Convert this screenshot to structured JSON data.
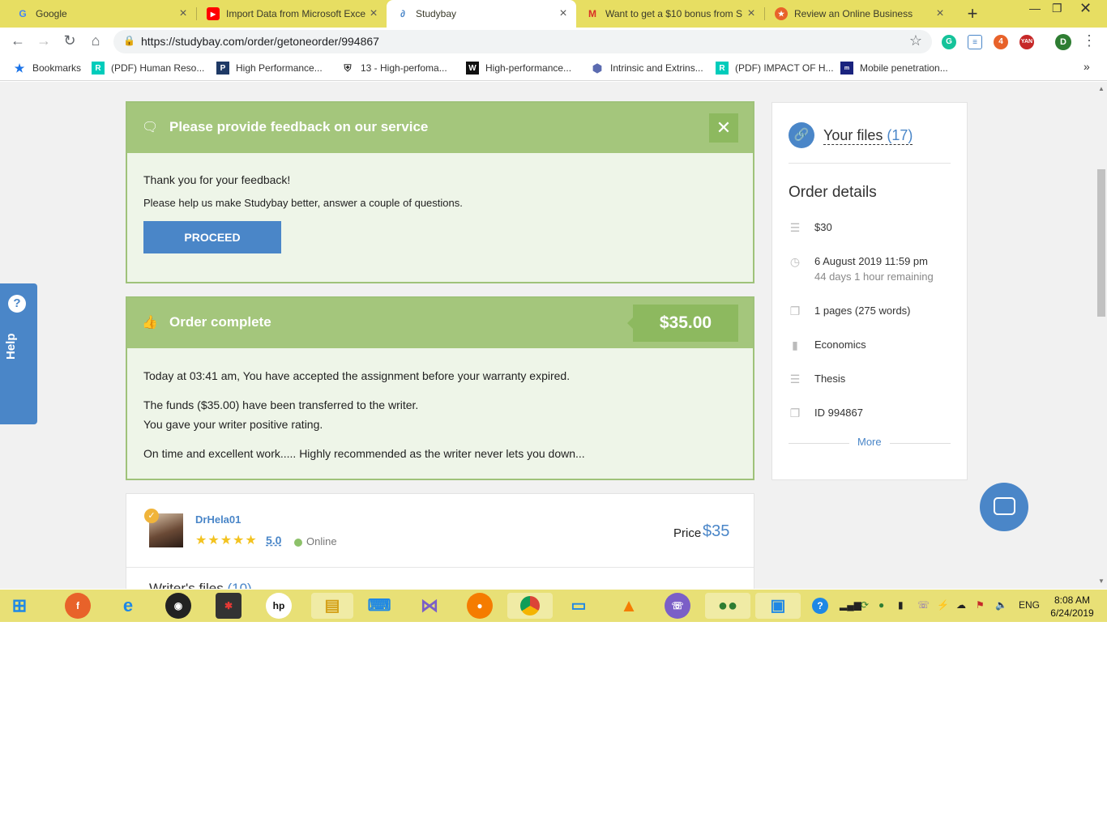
{
  "browser": {
    "tabs": [
      {
        "title": "Google",
        "icon": "google-icon"
      },
      {
        "title": "Import Data from Microsoft Exce",
        "icon": "youtube-icon"
      },
      {
        "title": "Studybay",
        "icon": "studybay-icon"
      },
      {
        "title": "Want to get a $10 bonus from S",
        "icon": "gmail-icon"
      },
      {
        "title": "Review an Online Business",
        "icon": "review-icon"
      }
    ],
    "url": "https://studybay.com/order/getoneorder/994867",
    "profile_initial": "D",
    "bookmarks": [
      {
        "label": "Bookmarks",
        "icon": "star-icon"
      },
      {
        "label": "(PDF) Human Reso...",
        "icon": "researchgate-icon"
      },
      {
        "label": "High Performance...",
        "icon": "p-icon"
      },
      {
        "label": "13 - High-perfoma...",
        "icon": "shield-icon"
      },
      {
        "label": "High-performance...",
        "icon": "w-icon"
      },
      {
        "label": "Intrinsic and Extrins...",
        "icon": "hex-icon"
      },
      {
        "label": "(PDF) IMPACT OF H...",
        "icon": "researchgate-icon"
      },
      {
        "label": "Mobile penetration...",
        "icon": "site-icon"
      }
    ]
  },
  "feedback": {
    "title": "Please provide feedback on our service",
    "thanks": "Thank you for your feedback!",
    "prompt": "Please help us make Studybay better, answer a couple of questions.",
    "button": "PROCEED"
  },
  "order": {
    "title": "Order complete",
    "price": "$35.00",
    "line1": "Today at 03:41 am, You have accepted the assignment before your warranty expired.",
    "line2": "The funds ($35.00) have been transferred to the writer.",
    "line3": "You gave your writer positive rating.",
    "line4": "On time and excellent work..... Highly recommended as the writer never lets you down..."
  },
  "writer": {
    "name": "DrHela01",
    "stars": "★★★★★",
    "rating": "5.0",
    "status": "Online",
    "price_label": "Price",
    "price": "$35",
    "files_label": "Writer's files",
    "files_count": "(10)"
  },
  "sidebar": {
    "files_label": "Your files",
    "files_count": "(17)",
    "details_title": "Order details",
    "amount": "$30",
    "deadline": "6 August 2019 11:59 pm",
    "remaining": "44 days 1 hour remaining",
    "pages": "1 pages (275 words)",
    "subject": "Economics",
    "type": "Thesis",
    "id": "ID 994867",
    "more": "More"
  },
  "help": {
    "label": "Help"
  },
  "taskbar": {
    "language": "ENG",
    "time": "8:08 AM",
    "date": "6/24/2019"
  },
  "colors": {
    "accent_green": "#a4c67c",
    "link_blue": "#4a86c8",
    "tab_strip": "#e7de62"
  }
}
